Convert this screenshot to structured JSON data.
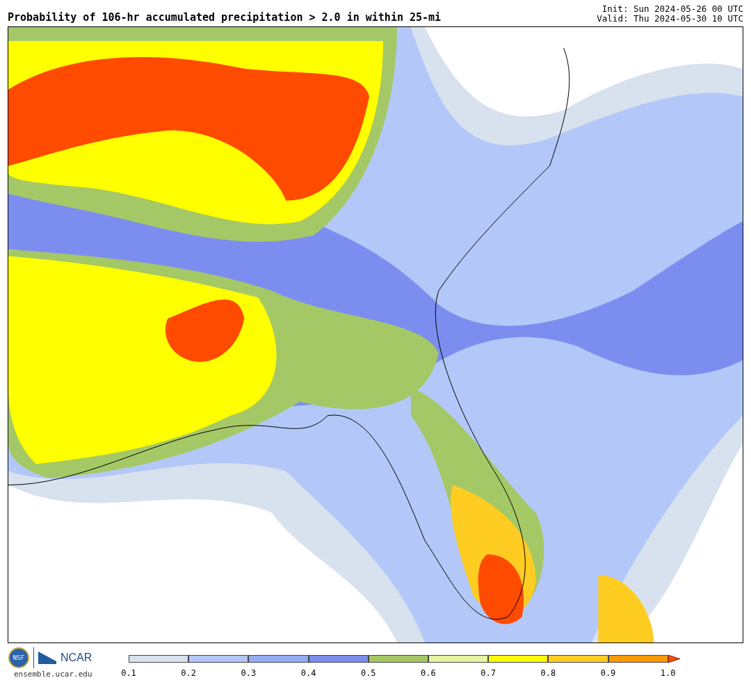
{
  "header": {
    "title": "Probability of 106-hr accumulated precipitation > 2.0 in within 25-mi",
    "init": "Init: Sun 2024-05-26 00 UTC",
    "valid": "Valid: Thu 2024-05-30 10 UTC"
  },
  "logos": {
    "nsf": "NSF",
    "ncar": "NCAR",
    "site": "ensemble.ucar.edu"
  },
  "legend": {
    "bins": [
      {
        "color": "#d8e2ee"
      },
      {
        "color": "#b3c8f8"
      },
      {
        "color": "#93acf4"
      },
      {
        "color": "#7b8ef0"
      },
      {
        "color": "#a5c866"
      },
      {
        "color": "#e6f5a2"
      },
      {
        "color": "#ffff00"
      },
      {
        "color": "#ffcc22"
      },
      {
        "color": "#ff9a00"
      }
    ],
    "over": {
      "color": "#ff4b00"
    },
    "ticks": [
      "0.1",
      "0.2",
      "0.3",
      "0.4",
      "0.5",
      "0.6",
      "0.7",
      "0.8",
      "0.9",
      "1.0"
    ]
  }
}
